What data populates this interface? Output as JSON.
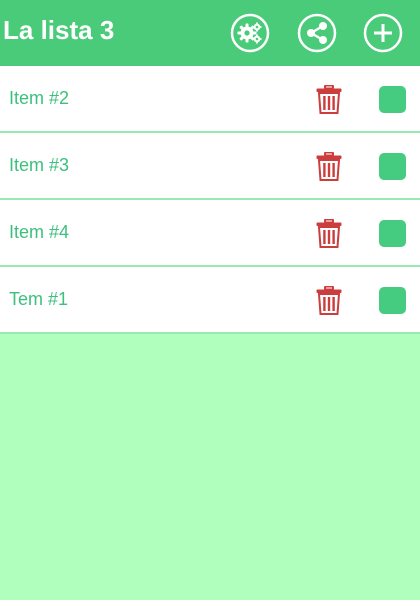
{
  "app_bar": {
    "title": "La lista 3",
    "background_color": "#4acb79",
    "actions": [
      {
        "name": "settings",
        "icon": "gears-icon"
      },
      {
        "name": "share",
        "icon": "share-icon"
      },
      {
        "name": "add",
        "icon": "plus-icon"
      }
    ]
  },
  "items": [
    {
      "label": "Item #2",
      "checked": false
    },
    {
      "label": "Item #3",
      "checked": false
    },
    {
      "label": "Item #4",
      "checked": false
    },
    {
      "label": "Tem #1",
      "checked": false
    }
  ],
  "icons": {
    "delete": "trash-icon",
    "checkbox": "checkbox-square"
  },
  "colors": {
    "accent": "#4acb79",
    "item_text": "#3dc07e",
    "trash": "#cc3d3d",
    "checkbox": "#45cc80",
    "background": "#b1ffbd",
    "divider": "#9ae8b4"
  }
}
